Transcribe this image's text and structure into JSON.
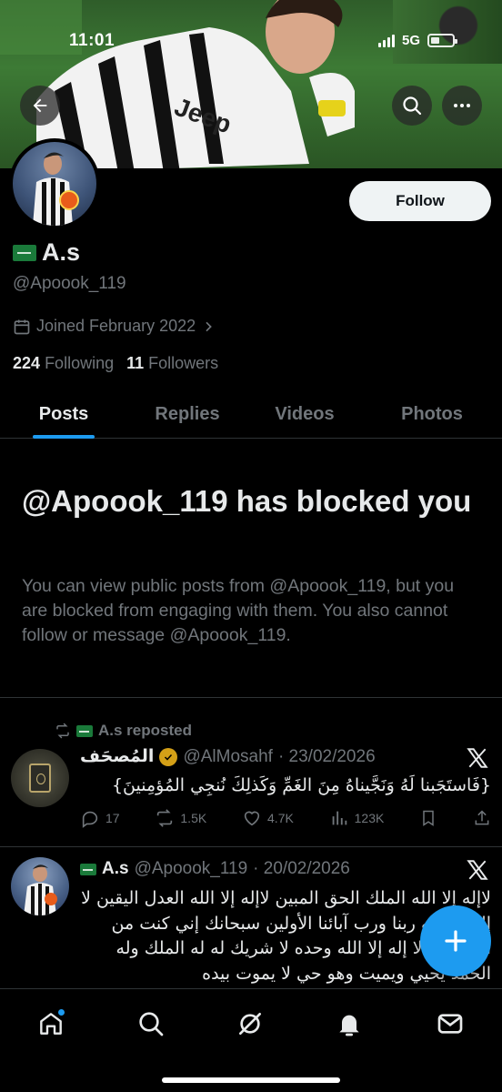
{
  "status_bar": {
    "time": "11:01",
    "network": "5G"
  },
  "header": {
    "back_icon": "arrow-left-icon",
    "search_icon": "search-icon",
    "more_icon": "ellipsis-icon"
  },
  "profile": {
    "display_name": "A.s",
    "handle": "@Apoook_119",
    "joined": "Joined February 2022",
    "following_count": "224",
    "following_label": "Following",
    "followers_count": "11",
    "followers_label": "Followers",
    "follow_label": "Follow"
  },
  "tabs": [
    {
      "label": "Posts",
      "active": true
    },
    {
      "label": "Replies",
      "active": false
    },
    {
      "label": "Videos",
      "active": false
    },
    {
      "label": "Photos",
      "active": false
    }
  ],
  "blocked": {
    "title": "@Apoook_119 has blocked you",
    "body": "You can view public posts from @Apoook_119, but you are blocked from engaging with them. You also cannot follow or message @Apoook_119."
  },
  "posts": [
    {
      "repost_label": "A.s reposted",
      "name": "المُصحَف",
      "handle": "@AlMosahf",
      "date": "· 23/02/2026",
      "text": "{فَاستَجَبنا لَهُ وَنَجَّيناهُ مِنَ الغَمِّ وَكَذلِكَ نُنجِي المُؤمِنينَ}",
      "replies": "17",
      "reposts": "1.5K",
      "likes": "4.7K",
      "views": "123K"
    },
    {
      "name": "A.s",
      "handle": "@Apoook_119",
      "date": "· 20/02/2026",
      "text": "لاإله إلا الله الملك الحق المبين لاإله إلا الله العدل اليقين لا إله إلا الله ربنا ورب آبائنا الأولين سبحانك إني كنت من الظالمين لا إله إلا الله وحده لا شريك له له الملك وله الحمد يحيي ويميت وهو حي لا يموت بيده"
    }
  ],
  "colors": {
    "accent": "#1d9bf0",
    "background": "#000000",
    "text_primary": "#e7e9ea",
    "text_secondary": "#71767b",
    "divider": "#2f3336"
  },
  "bottom_nav": [
    "home-icon",
    "search-icon",
    "grok-icon",
    "notifications-icon",
    "messages-icon"
  ]
}
